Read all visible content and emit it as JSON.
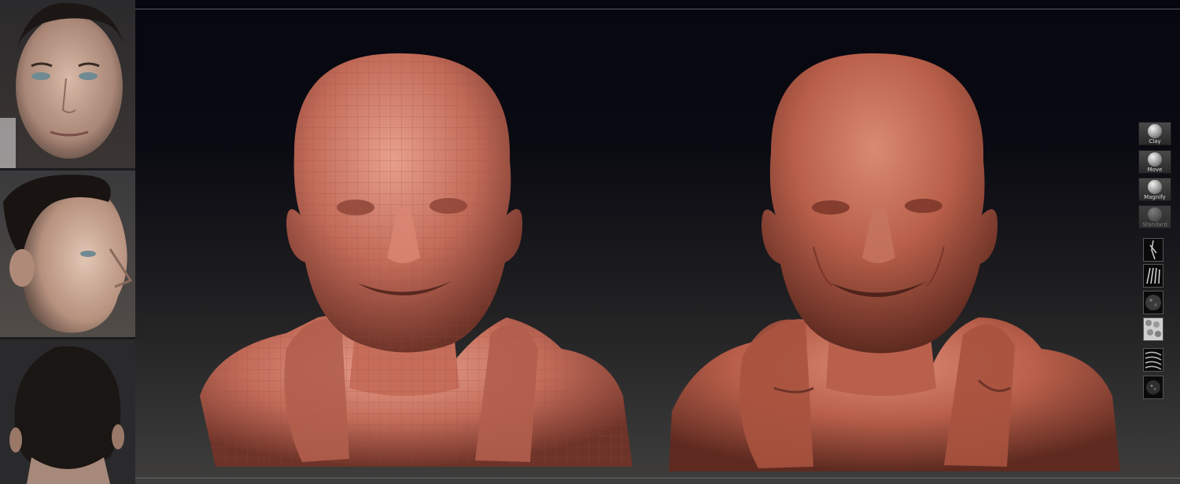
{
  "reference_photos": [
    "front-view-photo",
    "side-view-photo",
    "back-view-photo"
  ],
  "brushes": [
    {
      "label": "Clay",
      "enabled": true
    },
    {
      "label": "Move",
      "enabled": true
    },
    {
      "label": "Magnify",
      "enabled": true
    },
    {
      "label": "Standard",
      "enabled": false
    }
  ],
  "alphas": [
    "alpha-stroke-1",
    "alpha-stroke-2",
    "alpha-noise",
    "alpha-cells",
    "alpha-waves",
    "alpha-dots"
  ],
  "colors": {
    "clay": "#c16a58",
    "clay_shadow": "#6e3328",
    "clay_highlight": "#e39a86",
    "viewport_top": "#07070f",
    "viewport_bottom": "#3f3e3d"
  }
}
